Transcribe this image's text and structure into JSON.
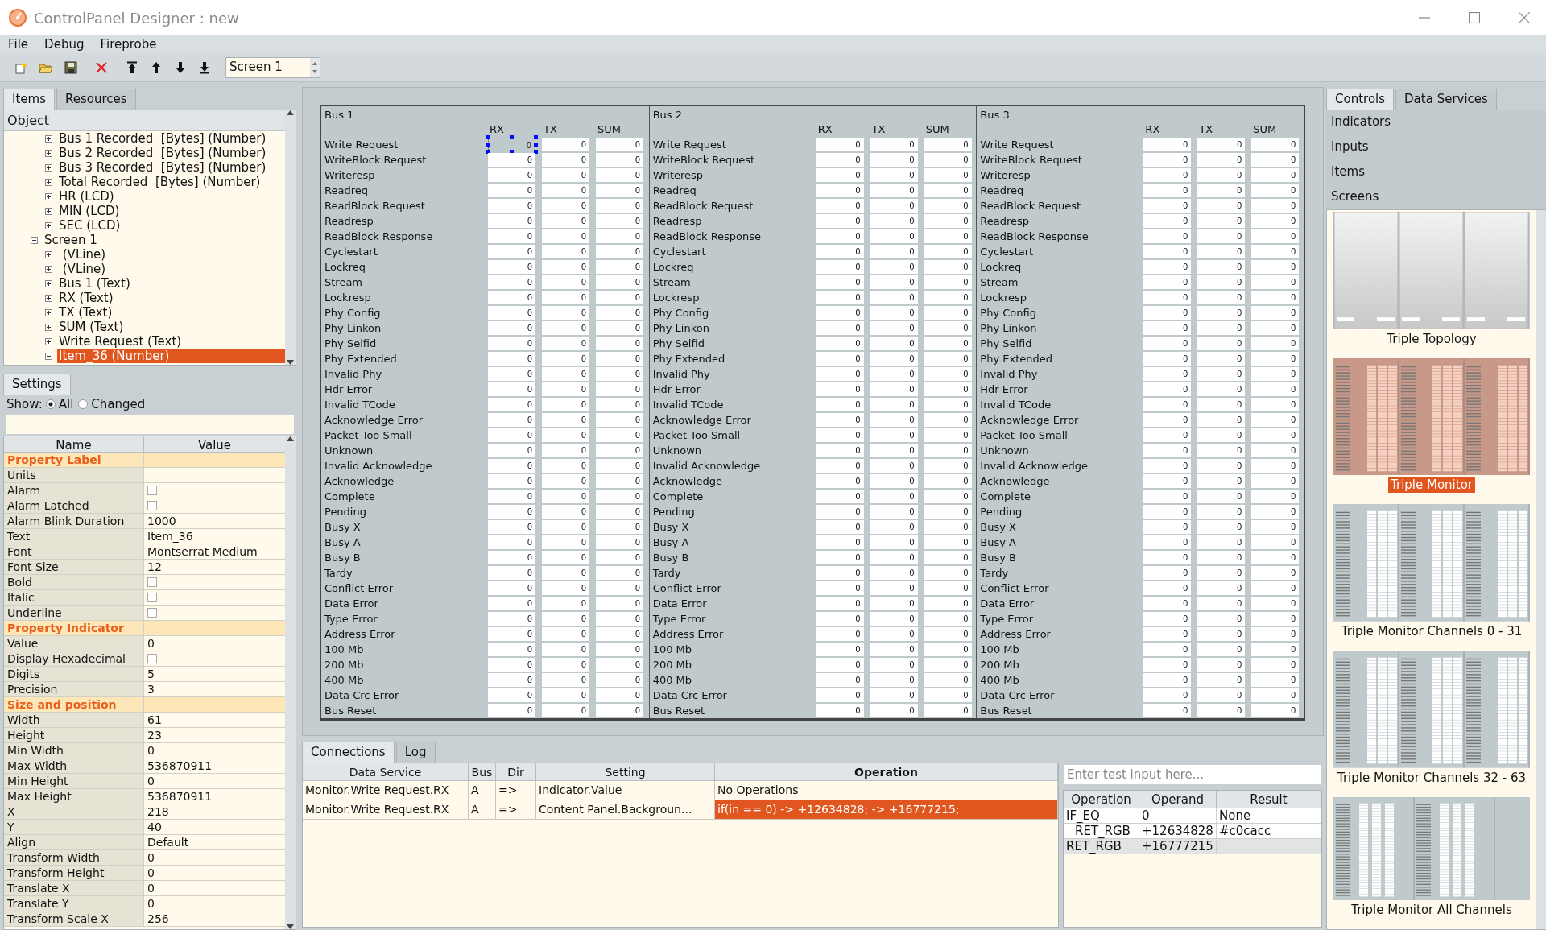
{
  "window": {
    "title": "ControlPanel Designer : new"
  },
  "menu": [
    "File",
    "Debug",
    "Fireprobe"
  ],
  "toolbar": {
    "screen_select": "Screen 1"
  },
  "left_tabs": [
    {
      "label": "Items",
      "selected": true
    },
    {
      "label": "Resources",
      "selected": false
    }
  ],
  "tree": {
    "header": "Object",
    "items": [
      {
        "kind": "continuation",
        "children": [
          {
            "label": "Bus 1 Recorded  [Bytes] (Number)",
            "expanded": false,
            "selected": false
          },
          {
            "label": "Bus 2 Recorded  [Bytes] (Number)",
            "expanded": false,
            "selected": false
          },
          {
            "label": "Bus 3 Recorded  [Bytes] (Number)",
            "expanded": false,
            "selected": false
          },
          {
            "label": "Total Recorded  [Bytes] (Number)",
            "expanded": false,
            "selected": false
          },
          {
            "label": "HR (LCD)",
            "expanded": false,
            "selected": false
          },
          {
            "label": "MIN (LCD)",
            "expanded": false,
            "selected": false
          },
          {
            "label": "SEC (LCD)",
            "expanded": false,
            "selected": false
          }
        ]
      },
      {
        "label": "Screen 1",
        "expanded": true,
        "selected": false,
        "children": [
          {
            "label": " (VLine)",
            "expanded": false,
            "selected": false
          },
          {
            "label": " (VLine)",
            "expanded": false,
            "selected": false
          },
          {
            "label": "Bus 1 (Text)",
            "expanded": false,
            "selected": false
          },
          {
            "label": "RX (Text)",
            "expanded": false,
            "selected": false
          },
          {
            "label": "TX (Text)",
            "expanded": false,
            "selected": false
          },
          {
            "label": "SUM (Text)",
            "expanded": false,
            "selected": false
          },
          {
            "label": "Write Request (Text)",
            "expanded": false,
            "selected": false
          },
          {
            "label": "Item_36 (Number)",
            "expanded": true,
            "selected": true
          }
        ]
      }
    ]
  },
  "settings": {
    "tab": "Settings",
    "show_label": "Show:",
    "show_options": [
      {
        "label": "All",
        "selected": true
      },
      {
        "label": "Changed",
        "selected": false
      }
    ],
    "columns": [
      "Name",
      "Value"
    ],
    "rows": [
      {
        "kind": "section",
        "name": "Property Label"
      },
      {
        "kind": "text",
        "name": "Units",
        "value": ""
      },
      {
        "kind": "checkbox",
        "name": "Alarm",
        "checked": false
      },
      {
        "kind": "checkbox",
        "name": "Alarm Latched",
        "checked": false
      },
      {
        "kind": "text",
        "name": "Alarm Blink Duration",
        "value": "1000"
      },
      {
        "kind": "text",
        "name": "Text",
        "value": "Item_36"
      },
      {
        "kind": "text",
        "name": "Font",
        "value": "Montserrat Medium"
      },
      {
        "kind": "text",
        "name": "Font Size",
        "value": "12"
      },
      {
        "kind": "checkbox",
        "name": "Bold",
        "checked": false
      },
      {
        "kind": "checkbox",
        "name": "Italic",
        "checked": false
      },
      {
        "kind": "checkbox",
        "name": "Underline",
        "checked": false
      },
      {
        "kind": "section",
        "name": "Property Indicator"
      },
      {
        "kind": "text",
        "name": "Value",
        "value": "0"
      },
      {
        "kind": "checkbox",
        "name": "Display Hexadecimal",
        "checked": false
      },
      {
        "kind": "text",
        "name": "Digits",
        "value": "5"
      },
      {
        "kind": "text",
        "name": "Precision",
        "value": "3"
      },
      {
        "kind": "section",
        "name": "Size and position"
      },
      {
        "kind": "text",
        "name": "Width",
        "value": "61"
      },
      {
        "kind": "text",
        "name": "Height",
        "value": "23"
      },
      {
        "kind": "text",
        "name": "Min Width",
        "value": "0"
      },
      {
        "kind": "text",
        "name": "Max Width",
        "value": "536870911"
      },
      {
        "kind": "text",
        "name": "Min Height",
        "value": "0"
      },
      {
        "kind": "text",
        "name": "Max Height",
        "value": "536870911"
      },
      {
        "kind": "text",
        "name": "X",
        "value": "218"
      },
      {
        "kind": "text",
        "name": "Y",
        "value": "40"
      },
      {
        "kind": "text",
        "name": "Align",
        "value": "Default"
      },
      {
        "kind": "text",
        "name": "Transform Width",
        "value": "0"
      },
      {
        "kind": "text",
        "name": "Transform Height",
        "value": "0"
      },
      {
        "kind": "text",
        "name": "Translate X",
        "value": "0"
      },
      {
        "kind": "text",
        "name": "Translate Y",
        "value": "0"
      },
      {
        "kind": "text",
        "name": "Transform Scale X",
        "value": "256"
      }
    ]
  },
  "monitor": {
    "buses": [
      {
        "title": "Bus 1",
        "columns": [
          "RX",
          "TX",
          "SUM"
        ],
        "rows": [
          {
            "label": "Write Request",
            "values": [
              "0",
              "0",
              "0"
            ],
            "selected": [
              true,
              false,
              false
            ]
          },
          {
            "label": "WriteBlock Request",
            "values": [
              "0",
              "0",
              "0"
            ],
            "selected": [
              false,
              false,
              false
            ]
          },
          {
            "label": "Writeresp",
            "values": [
              "0",
              "0",
              "0"
            ],
            "selected": [
              false,
              false,
              false
            ]
          },
          {
            "label": "Readreq",
            "values": [
              "0",
              "0",
              "0"
            ],
            "selected": [
              false,
              false,
              false
            ]
          },
          {
            "label": "ReadBlock Request",
            "values": [
              "0",
              "0",
              "0"
            ],
            "selected": [
              false,
              false,
              false
            ]
          },
          {
            "label": "Readresp",
            "values": [
              "0",
              "0",
              "0"
            ],
            "selected": [
              false,
              false,
              false
            ]
          },
          {
            "label": "ReadBlock Response",
            "values": [
              "0",
              "0",
              "0"
            ],
            "selected": [
              false,
              false,
              false
            ]
          },
          {
            "label": "Cyclestart",
            "values": [
              "0",
              "0",
              "0"
            ],
            "selected": [
              false,
              false,
              false
            ]
          },
          {
            "label": "Lockreq",
            "values": [
              "0",
              "0",
              "0"
            ],
            "selected": [
              false,
              false,
              false
            ]
          },
          {
            "label": "Stream",
            "values": [
              "0",
              "0",
              "0"
            ],
            "selected": [
              false,
              false,
              false
            ]
          },
          {
            "label": "Lockresp",
            "values": [
              "0",
              "0",
              "0"
            ],
            "selected": [
              false,
              false,
              false
            ]
          },
          {
            "label": "Phy Config",
            "values": [
              "0",
              "0",
              "0"
            ],
            "selected": [
              false,
              false,
              false
            ]
          },
          {
            "label": "Phy Linkon",
            "values": [
              "0",
              "0",
              "0"
            ],
            "selected": [
              false,
              false,
              false
            ]
          },
          {
            "label": "Phy Selfid",
            "values": [
              "0",
              "0",
              "0"
            ],
            "selected": [
              false,
              false,
              false
            ]
          },
          {
            "label": "Phy Extended",
            "values": [
              "0",
              "0",
              "0"
            ],
            "selected": [
              false,
              false,
              false
            ]
          },
          {
            "label": "Invalid Phy",
            "values": [
              "0",
              "0",
              "0"
            ],
            "selected": [
              false,
              false,
              false
            ]
          },
          {
            "label": "Hdr Error",
            "values": [
              "0",
              "0",
              "0"
            ],
            "selected": [
              false,
              false,
              false
            ]
          },
          {
            "label": "Invalid TCode",
            "values": [
              "0",
              "0",
              "0"
            ],
            "selected": [
              false,
              false,
              false
            ]
          },
          {
            "label": "Acknowledge Error",
            "values": [
              "0",
              "0",
              "0"
            ],
            "selected": [
              false,
              false,
              false
            ]
          },
          {
            "label": "Packet Too Small",
            "values": [
              "0",
              "0",
              "0"
            ],
            "selected": [
              false,
              false,
              false
            ]
          },
          {
            "label": "Unknown",
            "values": [
              "0",
              "0",
              "0"
            ],
            "selected": [
              false,
              false,
              false
            ]
          },
          {
            "label": "Invalid Acknowledge",
            "values": [
              "0",
              "0",
              "0"
            ],
            "selected": [
              false,
              false,
              false
            ]
          },
          {
            "label": "Acknowledge",
            "values": [
              "0",
              "0",
              "0"
            ],
            "selected": [
              false,
              false,
              false
            ]
          },
          {
            "label": "Complete",
            "values": [
              "0",
              "0",
              "0"
            ],
            "selected": [
              false,
              false,
              false
            ]
          },
          {
            "label": "Pending",
            "values": [
              "0",
              "0",
              "0"
            ],
            "selected": [
              false,
              false,
              false
            ]
          },
          {
            "label": "Busy X",
            "values": [
              "0",
              "0",
              "0"
            ],
            "selected": [
              false,
              false,
              false
            ]
          },
          {
            "label": "Busy A",
            "values": [
              "0",
              "0",
              "0"
            ],
            "selected": [
              false,
              false,
              false
            ]
          },
          {
            "label": "Busy B",
            "values": [
              "0",
              "0",
              "0"
            ],
            "selected": [
              false,
              false,
              false
            ]
          },
          {
            "label": "Tardy",
            "values": [
              "0",
              "0",
              "0"
            ],
            "selected": [
              false,
              false,
              false
            ]
          },
          {
            "label": "Conflict Error",
            "values": [
              "0",
              "0",
              "0"
            ],
            "selected": [
              false,
              false,
              false
            ]
          },
          {
            "label": "Data Error",
            "values": [
              "0",
              "0",
              "0"
            ],
            "selected": [
              false,
              false,
              false
            ]
          },
          {
            "label": "Type Error",
            "values": [
              "0",
              "0",
              "0"
            ],
            "selected": [
              false,
              false,
              false
            ]
          },
          {
            "label": "Address Error",
            "values": [
              "0",
              "0",
              "0"
            ],
            "selected": [
              false,
              false,
              false
            ]
          },
          {
            "label": "100 Mb",
            "values": [
              "0",
              "0",
              "0"
            ],
            "selected": [
              false,
              false,
              false
            ]
          },
          {
            "label": "200 Mb",
            "values": [
              "0",
              "0",
              "0"
            ],
            "selected": [
              false,
              false,
              false
            ]
          },
          {
            "label": "400 Mb",
            "values": [
              "0",
              "0",
              "0"
            ],
            "selected": [
              false,
              false,
              false
            ]
          },
          {
            "label": "Data Crc Error",
            "values": [
              "0",
              "0",
              "0"
            ],
            "selected": [
              false,
              false,
              false
            ]
          },
          {
            "label": "Bus Reset",
            "values": [
              "0",
              "0",
              "0"
            ],
            "selected": [
              false,
              false,
              false
            ]
          }
        ]
      },
      {
        "title": "Bus 2",
        "columns": [
          "RX",
          "TX",
          "SUM"
        ],
        "rows": [
          {
            "label": "Write Request",
            "values": [
              "0",
              "0",
              "0"
            ],
            "selected": [
              false,
              false,
              false
            ]
          },
          {
            "label": "WriteBlock Request",
            "values": [
              "0",
              "0",
              "0"
            ],
            "selected": [
              false,
              false,
              false
            ]
          },
          {
            "label": "Writeresp",
            "values": [
              "0",
              "0",
              "0"
            ],
            "selected": [
              false,
              false,
              false
            ]
          },
          {
            "label": "Readreq",
            "values": [
              "0",
              "0",
              "0"
            ],
            "selected": [
              false,
              false,
              false
            ]
          },
          {
            "label": "ReadBlock Request",
            "values": [
              "0",
              "0",
              "0"
            ],
            "selected": [
              false,
              false,
              false
            ]
          },
          {
            "label": "Readresp",
            "values": [
              "0",
              "0",
              "0"
            ],
            "selected": [
              false,
              false,
              false
            ]
          },
          {
            "label": "ReadBlock Response",
            "values": [
              "0",
              "0",
              "0"
            ],
            "selected": [
              false,
              false,
              false
            ]
          },
          {
            "label": "Cyclestart",
            "values": [
              "0",
              "0",
              "0"
            ],
            "selected": [
              false,
              false,
              false
            ]
          },
          {
            "label": "Lockreq",
            "values": [
              "0",
              "0",
              "0"
            ],
            "selected": [
              false,
              false,
              false
            ]
          },
          {
            "label": "Stream",
            "values": [
              "0",
              "0",
              "0"
            ],
            "selected": [
              false,
              false,
              false
            ]
          },
          {
            "label": "Lockresp",
            "values": [
              "0",
              "0",
              "0"
            ],
            "selected": [
              false,
              false,
              false
            ]
          },
          {
            "label": "Phy Config",
            "values": [
              "0",
              "0",
              "0"
            ],
            "selected": [
              false,
              false,
              false
            ]
          },
          {
            "label": "Phy Linkon",
            "values": [
              "0",
              "0",
              "0"
            ],
            "selected": [
              false,
              false,
              false
            ]
          },
          {
            "label": "Phy Selfid",
            "values": [
              "0",
              "0",
              "0"
            ],
            "selected": [
              false,
              false,
              false
            ]
          },
          {
            "label": "Phy Extended",
            "values": [
              "0",
              "0",
              "0"
            ],
            "selected": [
              false,
              false,
              false
            ]
          },
          {
            "label": "Invalid Phy",
            "values": [
              "0",
              "0",
              "0"
            ],
            "selected": [
              false,
              false,
              false
            ]
          },
          {
            "label": "Hdr Error",
            "values": [
              "0",
              "0",
              "0"
            ],
            "selected": [
              false,
              false,
              false
            ]
          },
          {
            "label": "Invalid TCode",
            "values": [
              "0",
              "0",
              "0"
            ],
            "selected": [
              false,
              false,
              false
            ]
          },
          {
            "label": "Acknowledge Error",
            "values": [
              "0",
              "0",
              "0"
            ],
            "selected": [
              false,
              false,
              false
            ]
          },
          {
            "label": "Packet Too Small",
            "values": [
              "0",
              "0",
              "0"
            ],
            "selected": [
              false,
              false,
              false
            ]
          },
          {
            "label": "Unknown",
            "values": [
              "0",
              "0",
              "0"
            ],
            "selected": [
              false,
              false,
              false
            ]
          },
          {
            "label": "Invalid Acknowledge",
            "values": [
              "0",
              "0",
              "0"
            ],
            "selected": [
              false,
              false,
              false
            ]
          },
          {
            "label": "Acknowledge",
            "values": [
              "0",
              "0",
              "0"
            ],
            "selected": [
              false,
              false,
              false
            ]
          },
          {
            "label": "Complete",
            "values": [
              "0",
              "0",
              "0"
            ],
            "selected": [
              false,
              false,
              false
            ]
          },
          {
            "label": "Pending",
            "values": [
              "0",
              "0",
              "0"
            ],
            "selected": [
              false,
              false,
              false
            ]
          },
          {
            "label": "Busy X",
            "values": [
              "0",
              "0",
              "0"
            ],
            "selected": [
              false,
              false,
              false
            ]
          },
          {
            "label": "Busy A",
            "values": [
              "0",
              "0",
              "0"
            ],
            "selected": [
              false,
              false,
              false
            ]
          },
          {
            "label": "Busy B",
            "values": [
              "0",
              "0",
              "0"
            ],
            "selected": [
              false,
              false,
              false
            ]
          },
          {
            "label": "Tardy",
            "values": [
              "0",
              "0",
              "0"
            ],
            "selected": [
              false,
              false,
              false
            ]
          },
          {
            "label": "Conflict Error",
            "values": [
              "0",
              "0",
              "0"
            ],
            "selected": [
              false,
              false,
              false
            ]
          },
          {
            "label": "Data Error",
            "values": [
              "0",
              "0",
              "0"
            ],
            "selected": [
              false,
              false,
              false
            ]
          },
          {
            "label": "Type Error",
            "values": [
              "0",
              "0",
              "0"
            ],
            "selected": [
              false,
              false,
              false
            ]
          },
          {
            "label": "Address Error",
            "values": [
              "0",
              "0",
              "0"
            ],
            "selected": [
              false,
              false,
              false
            ]
          },
          {
            "label": "100 Mb",
            "values": [
              "0",
              "0",
              "0"
            ],
            "selected": [
              false,
              false,
              false
            ]
          },
          {
            "label": "200 Mb",
            "values": [
              "0",
              "0",
              "0"
            ],
            "selected": [
              false,
              false,
              false
            ]
          },
          {
            "label": "400 Mb",
            "values": [
              "0",
              "0",
              "0"
            ],
            "selected": [
              false,
              false,
              false
            ]
          },
          {
            "label": "Data Crc Error",
            "values": [
              "0",
              "0",
              "0"
            ],
            "selected": [
              false,
              false,
              false
            ]
          },
          {
            "label": "Bus Reset",
            "values": [
              "0",
              "0",
              "0"
            ],
            "selected": [
              false,
              false,
              false
            ]
          }
        ]
      },
      {
        "title": "Bus 3",
        "columns": [
          "RX",
          "TX",
          "SUM"
        ],
        "rows": [
          {
            "label": "Write Request",
            "values": [
              "0",
              "0",
              "0"
            ],
            "selected": [
              false,
              false,
              false
            ]
          },
          {
            "label": "WriteBlock Request",
            "values": [
              "0",
              "0",
              "0"
            ],
            "selected": [
              false,
              false,
              false
            ]
          },
          {
            "label": "Writeresp",
            "values": [
              "0",
              "0",
              "0"
            ],
            "selected": [
              false,
              false,
              false
            ]
          },
          {
            "label": "Readreq",
            "values": [
              "0",
              "0",
              "0"
            ],
            "selected": [
              false,
              false,
              false
            ]
          },
          {
            "label": "ReadBlock Request",
            "values": [
              "0",
              "0",
              "0"
            ],
            "selected": [
              false,
              false,
              false
            ]
          },
          {
            "label": "Readresp",
            "values": [
              "0",
              "0",
              "0"
            ],
            "selected": [
              false,
              false,
              false
            ]
          },
          {
            "label": "ReadBlock Response",
            "values": [
              "0",
              "0",
              "0"
            ],
            "selected": [
              false,
              false,
              false
            ]
          },
          {
            "label": "Cyclestart",
            "values": [
              "0",
              "0",
              "0"
            ],
            "selected": [
              false,
              false,
              false
            ]
          },
          {
            "label": "Lockreq",
            "values": [
              "0",
              "0",
              "0"
            ],
            "selected": [
              false,
              false,
              false
            ]
          },
          {
            "label": "Stream",
            "values": [
              "0",
              "0",
              "0"
            ],
            "selected": [
              false,
              false,
              false
            ]
          },
          {
            "label": "Lockresp",
            "values": [
              "0",
              "0",
              "0"
            ],
            "selected": [
              false,
              false,
              false
            ]
          },
          {
            "label": "Phy Config",
            "values": [
              "0",
              "0",
              "0"
            ],
            "selected": [
              false,
              false,
              false
            ]
          },
          {
            "label": "Phy Linkon",
            "values": [
              "0",
              "0",
              "0"
            ],
            "selected": [
              false,
              false,
              false
            ]
          },
          {
            "label": "Phy Selfid",
            "values": [
              "0",
              "0",
              "0"
            ],
            "selected": [
              false,
              false,
              false
            ]
          },
          {
            "label": "Phy Extended",
            "values": [
              "0",
              "0",
              "0"
            ],
            "selected": [
              false,
              false,
              false
            ]
          },
          {
            "label": "Invalid Phy",
            "values": [
              "0",
              "0",
              "0"
            ],
            "selected": [
              false,
              false,
              false
            ]
          },
          {
            "label": "Hdr Error",
            "values": [
              "0",
              "0",
              "0"
            ],
            "selected": [
              false,
              false,
              false
            ]
          },
          {
            "label": "Invalid TCode",
            "values": [
              "0",
              "0",
              "0"
            ],
            "selected": [
              false,
              false,
              false
            ]
          },
          {
            "label": "Acknowledge Error",
            "values": [
              "0",
              "0",
              "0"
            ],
            "selected": [
              false,
              false,
              false
            ]
          },
          {
            "label": "Packet Too Small",
            "values": [
              "0",
              "0",
              "0"
            ],
            "selected": [
              false,
              false,
              false
            ]
          },
          {
            "label": "Unknown",
            "values": [
              "0",
              "0",
              "0"
            ],
            "selected": [
              false,
              false,
              false
            ]
          },
          {
            "label": "Invalid Acknowledge",
            "values": [
              "0",
              "0",
              "0"
            ],
            "selected": [
              false,
              false,
              false
            ]
          },
          {
            "label": "Acknowledge",
            "values": [
              "0",
              "0",
              "0"
            ],
            "selected": [
              false,
              false,
              false
            ]
          },
          {
            "label": "Complete",
            "values": [
              "0",
              "0",
              "0"
            ],
            "selected": [
              false,
              false,
              false
            ]
          },
          {
            "label": "Pending",
            "values": [
              "0",
              "0",
              "0"
            ],
            "selected": [
              false,
              false,
              false
            ]
          },
          {
            "label": "Busy X",
            "values": [
              "0",
              "0",
              "0"
            ],
            "selected": [
              false,
              false,
              false
            ]
          },
          {
            "label": "Busy A",
            "values": [
              "0",
              "0",
              "0"
            ],
            "selected": [
              false,
              false,
              false
            ]
          },
          {
            "label": "Busy B",
            "values": [
              "0",
              "0",
              "0"
            ],
            "selected": [
              false,
              false,
              false
            ]
          },
          {
            "label": "Tardy",
            "values": [
              "0",
              "0",
              "0"
            ],
            "selected": [
              false,
              false,
              false
            ]
          },
          {
            "label": "Conflict Error",
            "values": [
              "0",
              "0",
              "0"
            ],
            "selected": [
              false,
              false,
              false
            ]
          },
          {
            "label": "Data Error",
            "values": [
              "0",
              "0",
              "0"
            ],
            "selected": [
              false,
              false,
              false
            ]
          },
          {
            "label": "Type Error",
            "values": [
              "0",
              "0",
              "0"
            ],
            "selected": [
              false,
              false,
              false
            ]
          },
          {
            "label": "Address Error",
            "values": [
              "0",
              "0",
              "0"
            ],
            "selected": [
              false,
              false,
              false
            ]
          },
          {
            "label": "100 Mb",
            "values": [
              "0",
              "0",
              "0"
            ],
            "selected": [
              false,
              false,
              false
            ]
          },
          {
            "label": "200 Mb",
            "values": [
              "0",
              "0",
              "0"
            ],
            "selected": [
              false,
              false,
              false
            ]
          },
          {
            "label": "400 Mb",
            "values": [
              "0",
              "0",
              "0"
            ],
            "selected": [
              false,
              false,
              false
            ]
          },
          {
            "label": "Data Crc Error",
            "values": [
              "0",
              "0",
              "0"
            ],
            "selected": [
              false,
              false,
              false
            ]
          },
          {
            "label": "Bus Reset",
            "values": [
              "0",
              "0",
              "0"
            ],
            "selected": [
              false,
              false,
              false
            ]
          }
        ]
      }
    ]
  },
  "bottom_tabs": [
    {
      "label": "Connections",
      "selected": true
    },
    {
      "label": "Log",
      "selected": false
    }
  ],
  "connections": {
    "columns": [
      {
        "label": "Data Service",
        "emphasized": false
      },
      {
        "label": "Bus",
        "emphasized": false
      },
      {
        "label": "Dir",
        "emphasized": false
      },
      {
        "label": "Setting",
        "emphasized": false
      },
      {
        "label": "Operation",
        "emphasized": true
      }
    ],
    "rows": [
      {
        "cells": [
          "Monitor.Write Request.RX",
          "A",
          "=>",
          "Indicator.Value",
          "No Operations"
        ],
        "selected": false
      },
      {
        "cells": [
          "Monitor.Write Request.RX",
          "A",
          "=>",
          "Content Panel.Backgroun...",
          "if(in == 0) -> +12634828; -> +16777215;"
        ],
        "selected": true
      }
    ]
  },
  "test": {
    "input": {
      "placeholder": "Enter test input here..."
    },
    "columns": [
      "Operation",
      "Operand",
      "Result"
    ],
    "rows": [
      {
        "cells": [
          "IF_EQ",
          "0",
          "None"
        ],
        "selected": false,
        "children": [
          {
            "cells": [
              "RET_RGB",
              "+12634828",
              "#c0cacc"
            ],
            "selected": false
          }
        ]
      },
      {
        "cells": [
          "RET_RGB",
          "+16777215",
          ""
        ],
        "selected": true
      }
    ]
  },
  "right_tabs": [
    {
      "label": "Controls",
      "selected": true
    },
    {
      "label": "Data Services",
      "selected": false
    }
  ],
  "categories": [
    {
      "label": "Indicators"
    },
    {
      "label": "Inputs"
    },
    {
      "label": "Items"
    },
    {
      "label": "Screens"
    }
  ],
  "screens": [
    {
      "label": "Triple Topology",
      "kind": "topology",
      "selected": false
    },
    {
      "label": "Triple Monitor",
      "kind": "monitor",
      "selected": true
    },
    {
      "label": "Triple Monitor Channels 0 - 31",
      "kind": "channels",
      "selected": false
    },
    {
      "label": "Triple Monitor Channels 32 - 63",
      "kind": "channels",
      "selected": false
    },
    {
      "label": "Triple Monitor All Channels",
      "kind": "all_channels",
      "selected": false
    }
  ]
}
